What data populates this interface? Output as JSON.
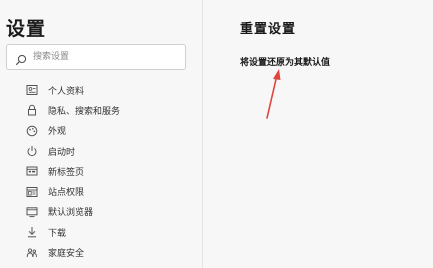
{
  "sidebar": {
    "title": "设置",
    "search": {
      "placeholder": "搜索设置",
      "value": ""
    },
    "items": [
      {
        "label": "个人资料",
        "icon": "profile-icon"
      },
      {
        "label": "隐私、搜索和服务",
        "icon": "lock-icon"
      },
      {
        "label": "外观",
        "icon": "appearance-icon"
      },
      {
        "label": "启动时",
        "icon": "power-icon"
      },
      {
        "label": "新标签页",
        "icon": "new-tab-icon"
      },
      {
        "label": "站点权限",
        "icon": "site-permissions-icon"
      },
      {
        "label": "默认浏览器",
        "icon": "default-browser-icon"
      },
      {
        "label": "下载",
        "icon": "download-icon"
      },
      {
        "label": "家庭安全",
        "icon": "family-safety-icon"
      }
    ]
  },
  "main": {
    "title": "重置设置",
    "reset_label": "将设置还原为其默认值"
  },
  "colors": {
    "background": "#f7f7f7",
    "text": "#1a1a1a",
    "annotation_arrow": "#e0443c"
  }
}
